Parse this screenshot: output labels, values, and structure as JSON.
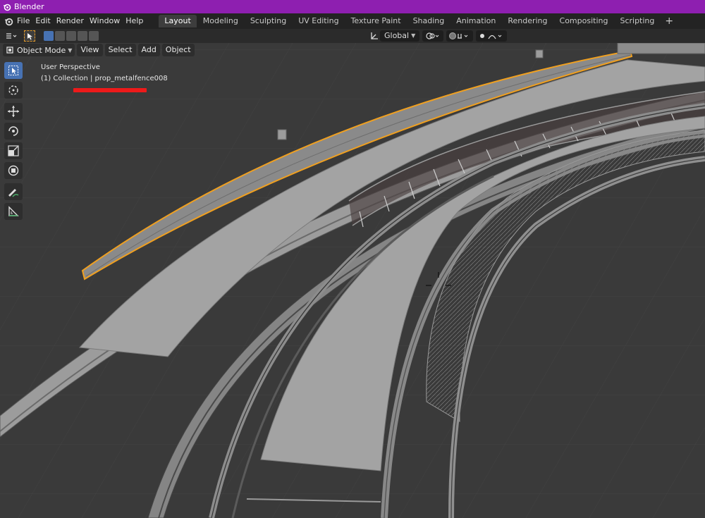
{
  "window": {
    "title": "Blender"
  },
  "menu": [
    "File",
    "Edit",
    "Render",
    "Window",
    "Help"
  ],
  "workspace_tabs": [
    {
      "label": "Layout",
      "active": true
    },
    {
      "label": "Modeling"
    },
    {
      "label": "Sculpting"
    },
    {
      "label": "UV Editing"
    },
    {
      "label": "Texture Paint"
    },
    {
      "label": "Shading"
    },
    {
      "label": "Animation"
    },
    {
      "label": "Rendering"
    },
    {
      "label": "Compositing"
    },
    {
      "label": "Scripting"
    }
  ],
  "tool_header": {
    "orientation": "Global"
  },
  "viewport_header": {
    "mode": "Object Mode",
    "menus": [
      "View",
      "Select",
      "Add",
      "Object"
    ]
  },
  "overlay": {
    "view_name": "User Perspective",
    "collection": "(1) Collection | prop_metalfence008"
  },
  "tools": [
    {
      "icon": "select-box-icon",
      "active": true
    },
    {
      "icon": "cursor-icon"
    },
    {
      "icon": "move-icon"
    },
    {
      "icon": "rotate-icon"
    },
    {
      "icon": "scale-icon"
    },
    {
      "icon": "transform-icon"
    },
    {
      "icon": "annotate-icon"
    },
    {
      "icon": "measure-icon"
    }
  ],
  "colors": {
    "titlebar": "#8e1fb0",
    "selection_outline": "#f0a020",
    "active_tool": "#4772b3",
    "annotation": "#ee1a1a"
  }
}
